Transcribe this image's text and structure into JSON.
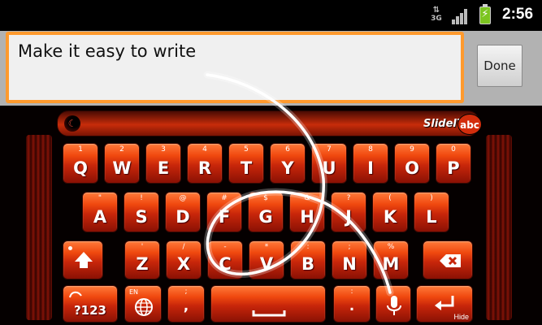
{
  "status": {
    "network": "3G",
    "time": "2:56"
  },
  "input": {
    "text": "Make it easy to write",
    "done_label": "Done"
  },
  "keyboard": {
    "brand": "SlideIT",
    "brand_badge": "abc",
    "accent_color": "#e43a0c",
    "row1": [
      {
        "label": "Q",
        "sup": "1"
      },
      {
        "label": "W",
        "sup": "2"
      },
      {
        "label": "E",
        "sup": "3"
      },
      {
        "label": "R",
        "sup": "4"
      },
      {
        "label": "T",
        "sup": "5"
      },
      {
        "label": "Y",
        "sup": "6"
      },
      {
        "label": "U",
        "sup": "7"
      },
      {
        "label": "I",
        "sup": "8"
      },
      {
        "label": "O",
        "sup": "9"
      },
      {
        "label": "P",
        "sup": "0"
      }
    ],
    "row2": [
      {
        "label": "A",
        "sup": "\""
      },
      {
        "label": "S",
        "sup": "!"
      },
      {
        "label": "D",
        "sup": "@"
      },
      {
        "label": "F",
        "sup": "#"
      },
      {
        "label": "G",
        "sup": "$"
      },
      {
        "label": "H",
        "sup": "&"
      },
      {
        "label": "J",
        "sup": "?"
      },
      {
        "label": "K",
        "sup": "("
      },
      {
        "label": "L",
        "sup": ")"
      }
    ],
    "row3": [
      {
        "label": "Z",
        "sup": "'"
      },
      {
        "label": "X",
        "sup": "/"
      },
      {
        "label": "C",
        "sup": "-"
      },
      {
        "label": "V",
        "sup": "*"
      },
      {
        "label": "B",
        "sup": ":"
      },
      {
        "label": "N",
        "sup": ";"
      },
      {
        "label": "M",
        "sup": "%"
      }
    ],
    "shift_icon": "shift-arrow-icon",
    "backspace_icon": "backspace-icon",
    "symbols_label": "?123",
    "language_label": "EN",
    "globe_icon": "globe-icon",
    "comma_label": ",",
    "comma_sup": ";",
    "period_label": ".",
    "period_sup": ":",
    "mic_icon": "microphone-icon",
    "enter_icon": "enter-icon",
    "hide_label": "Hide"
  }
}
